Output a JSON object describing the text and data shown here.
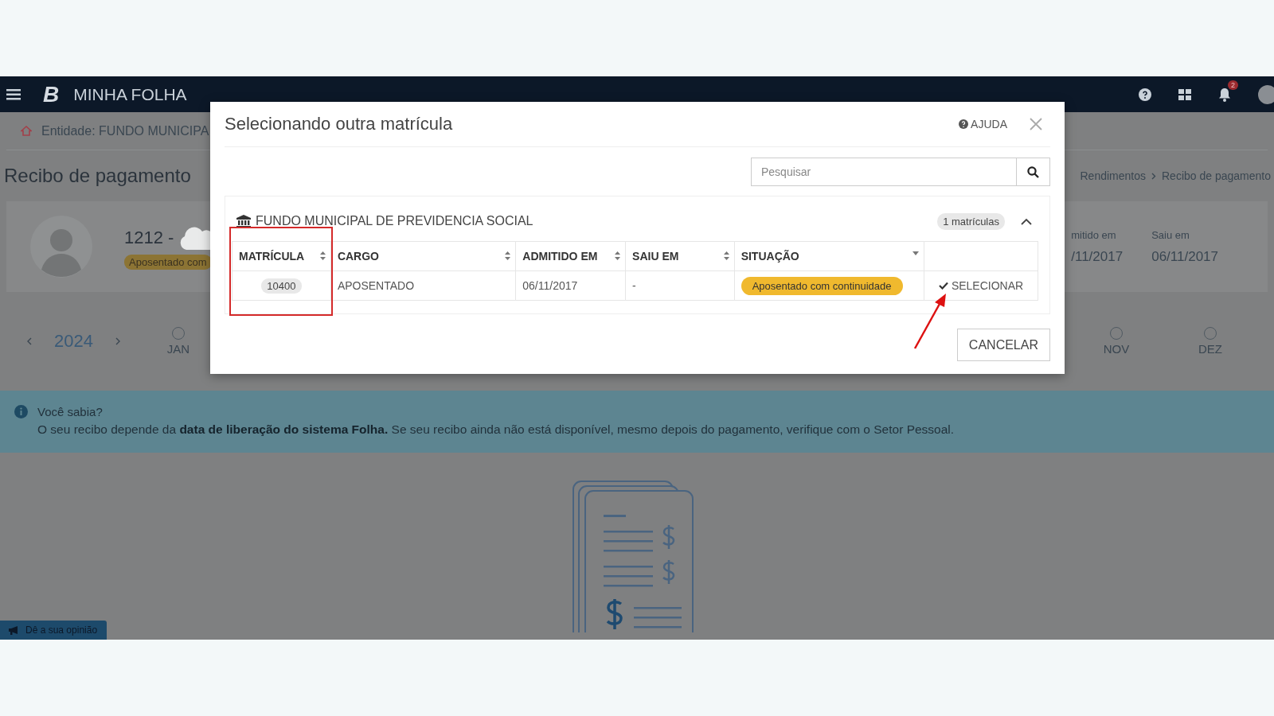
{
  "navbar": {
    "brand_letter": "B",
    "brand": "MINHA FOLHA",
    "notification_count": "2"
  },
  "page": {
    "entity": "Entidade: FUNDO MUNICIPA",
    "title": "Recibo de pagamento",
    "breadcrumb": [
      "Rendimentos",
      "Recibo de pagamento"
    ],
    "profile": {
      "id": "1212 -",
      "status": "Aposentado com",
      "fields": [
        {
          "label": "mitido em",
          "value": "/11/2017"
        },
        {
          "label": "Saiu em",
          "value": "06/11/2017"
        }
      ]
    },
    "year": "2024",
    "months": [
      {
        "label": "JAN"
      },
      {
        "label": "NOV"
      },
      {
        "label": "DEZ"
      }
    ],
    "notice": {
      "title": "Você sabia?",
      "text": "O seu recibo depende da **data de liberação do sistema Folha.** Se seu recibo ainda não está disponível, mesmo depois do pagamento, verifique com o Setor Pessoal."
    },
    "feedback_button": "Dê a sua opinião"
  },
  "modal": {
    "title": "Selecionando outra matrícula",
    "help": "AJUDA",
    "search": {
      "placeholder": "Pesquisar"
    },
    "group": {
      "name": "FUNDO MUNICIPAL DE PREVIDENCIA SOCIAL",
      "count": "1 matrículas",
      "expanded": true,
      "columns": [
        {
          "label": "MATRÍCULA",
          "kind": "sort"
        },
        {
          "label": "CARGO",
          "kind": "sort"
        },
        {
          "label": "ADMITIDO EM",
          "kind": "sort"
        },
        {
          "label": "SAIU EM",
          "kind": "sort"
        },
        {
          "label": "SITUAÇÃO",
          "kind": "filter"
        },
        {
          "kind": "blank"
        }
      ],
      "rows": [
        {
          "matricula": "10400",
          "cargo": "APOSENTADO",
          "admitido": "06/11/2017",
          "saiu": "-",
          "situacao": "Aposentado com continuidade",
          "action": "SELECIONAR"
        }
      ]
    },
    "cancel": "CANCELAR"
  }
}
